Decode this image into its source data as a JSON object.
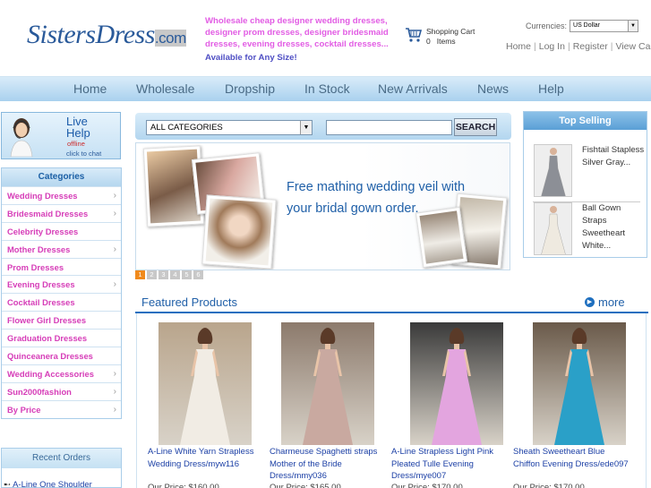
{
  "header": {
    "logo_main": "SistersDress",
    "logo_suffix": ".com",
    "tagline": "Wholesale cheap designer wedding dresses, designer prom dresses, designer bridesmaid dresses, evening dresses, cocktail dresses...",
    "tagline_sub": "Available for Any Size!",
    "cart_label": "Shopping Cart",
    "cart_items": "0   Items",
    "currency_label": "Currencies:",
    "currency_value": "US Dollar",
    "links": [
      "Home",
      "Log In",
      "Register",
      "View Cart"
    ]
  },
  "nav": {
    "items": [
      "Home",
      "Wholesale",
      "Dropship",
      "In Stock",
      "New Arrivals",
      "News",
      "Help"
    ]
  },
  "livehelp": {
    "title_line1": "Live",
    "title_line2": "Help",
    "status": "offline",
    "action": "click to chat"
  },
  "categories": {
    "title": "Categories",
    "items": [
      {
        "label": "Wedding Dresses",
        "chevron": true
      },
      {
        "label": "Bridesmaid Dresses",
        "chevron": true
      },
      {
        "label": "Celebrity Dresses",
        "chevron": false
      },
      {
        "label": "Mother Dresses",
        "chevron": true
      },
      {
        "label": "Prom Dresses",
        "chevron": false
      },
      {
        "label": "Evening Dresses",
        "chevron": true
      },
      {
        "label": "Cocktail Dresses",
        "chevron": false
      },
      {
        "label": "Flower Girl Dresses",
        "chevron": false
      },
      {
        "label": "Graduation Dresses",
        "chevron": false
      },
      {
        "label": "Quinceanera Dresses",
        "chevron": false
      },
      {
        "label": "Wedding Accessories",
        "chevron": true
      },
      {
        "label": "Sun2000fashion",
        "chevron": true
      },
      {
        "label": "By Price",
        "chevron": true
      }
    ]
  },
  "recent_orders": {
    "title": "Recent Orders",
    "first_item": "A-Line One Shoulder"
  },
  "search": {
    "category": "ALL CATEGORIES",
    "input_value": "",
    "button": "SEARCH"
  },
  "banner": {
    "text": "Free mathing wedding veil with your bridal gown order.",
    "slides": [
      "1",
      "2",
      "3",
      "4",
      "5",
      "6"
    ],
    "active_slide": 0
  },
  "featured": {
    "title": "Featured Products",
    "more": "more",
    "products": [
      {
        "name": "A-Line White Yarn Strapless Wedding Dress/myw116",
        "price": "Our Price: $160.00",
        "dress_color": "#f1ece4",
        "bg": "#b9a58c"
      },
      {
        "name": "Charmeuse Spaghetti straps Mother of the Bride Dress/mmy036",
        "price": "Our Price: $165.00",
        "dress_color": "#c9a9a0",
        "bg": "#8c7a6c"
      },
      {
        "name": "A-Line Strapless Light Pink Pleated Tulle Evening Dress/mye007",
        "price": "Our Price: $170.00",
        "dress_color": "#e3a5df",
        "bg": "#3a3a3a"
      },
      {
        "name": "Sheath Sweetheart Blue Chiffon Evening Dress/ede097",
        "price": "Our Price: $170.00",
        "dress_color": "#2aa0c8",
        "bg": "#6a5a4a"
      }
    ]
  },
  "top_selling": {
    "title": "Top Selling",
    "items": [
      {
        "name": "Fishtail Stapless Silver Gray...",
        "dress_color": "#8c8f96"
      },
      {
        "name": "Ball Gown Straps Sweetheart White...",
        "dress_color": "#efeae0"
      }
    ]
  }
}
